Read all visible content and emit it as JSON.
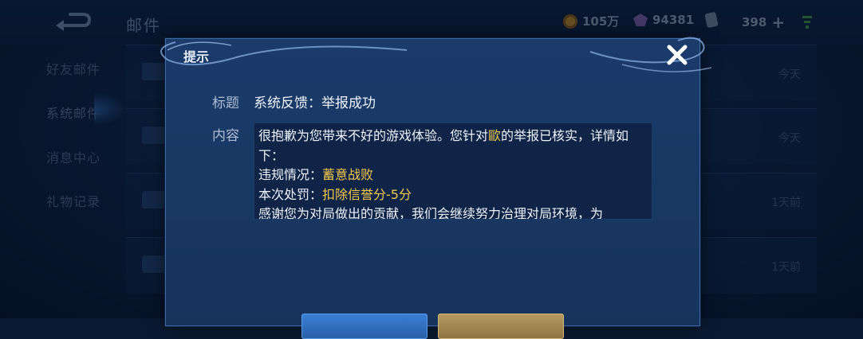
{
  "header": {
    "title": "邮件",
    "gold": "105万",
    "diamonds": "94381",
    "tickets": "398",
    "plus_symbol": "+"
  },
  "sidebar": {
    "items": [
      {
        "label": "好友邮件"
      },
      {
        "label": "系统邮件"
      },
      {
        "label": "消息中心"
      },
      {
        "label": "礼物记录"
      }
    ]
  },
  "mail_list": {
    "rows": [
      {
        "time": "今天"
      },
      {
        "time": "今天"
      },
      {
        "time": "1天前"
      },
      {
        "time": "1天前"
      }
    ]
  },
  "dialog": {
    "title": "提示",
    "subject_label": "标题",
    "subject": "系统反馈：举报成功",
    "content_label": "内容",
    "content": {
      "line1_pre": "很抱歉为您带来不好的游戏体验。您针对",
      "line1_name": "歐",
      "line1_post": "的举报已核实，详情如下：",
      "violation_label": "违规情况：",
      "violation_value": "蓄意战败",
      "penalty_label": "本次处罚：",
      "penalty_value": "扣除信誉分-5分",
      "line_last": "感谢您为对局做出的贡献，我们会继续努力治理对局环境，为"
    }
  },
  "colors": {
    "highlight": "#f2c94c",
    "dialog_bg": "#1b3b6b",
    "confirm_button": "#3b7fd4",
    "secondary_button": "#b79a5f"
  },
  "icons": {
    "back": "back-arrow-icon",
    "gold": "gold-coin-icon",
    "diamond": "diamond-icon",
    "ticket": "ticket-icon",
    "wifi": "wifi-signal-icon",
    "close": "close-icon",
    "envelope": "envelope-icon"
  }
}
